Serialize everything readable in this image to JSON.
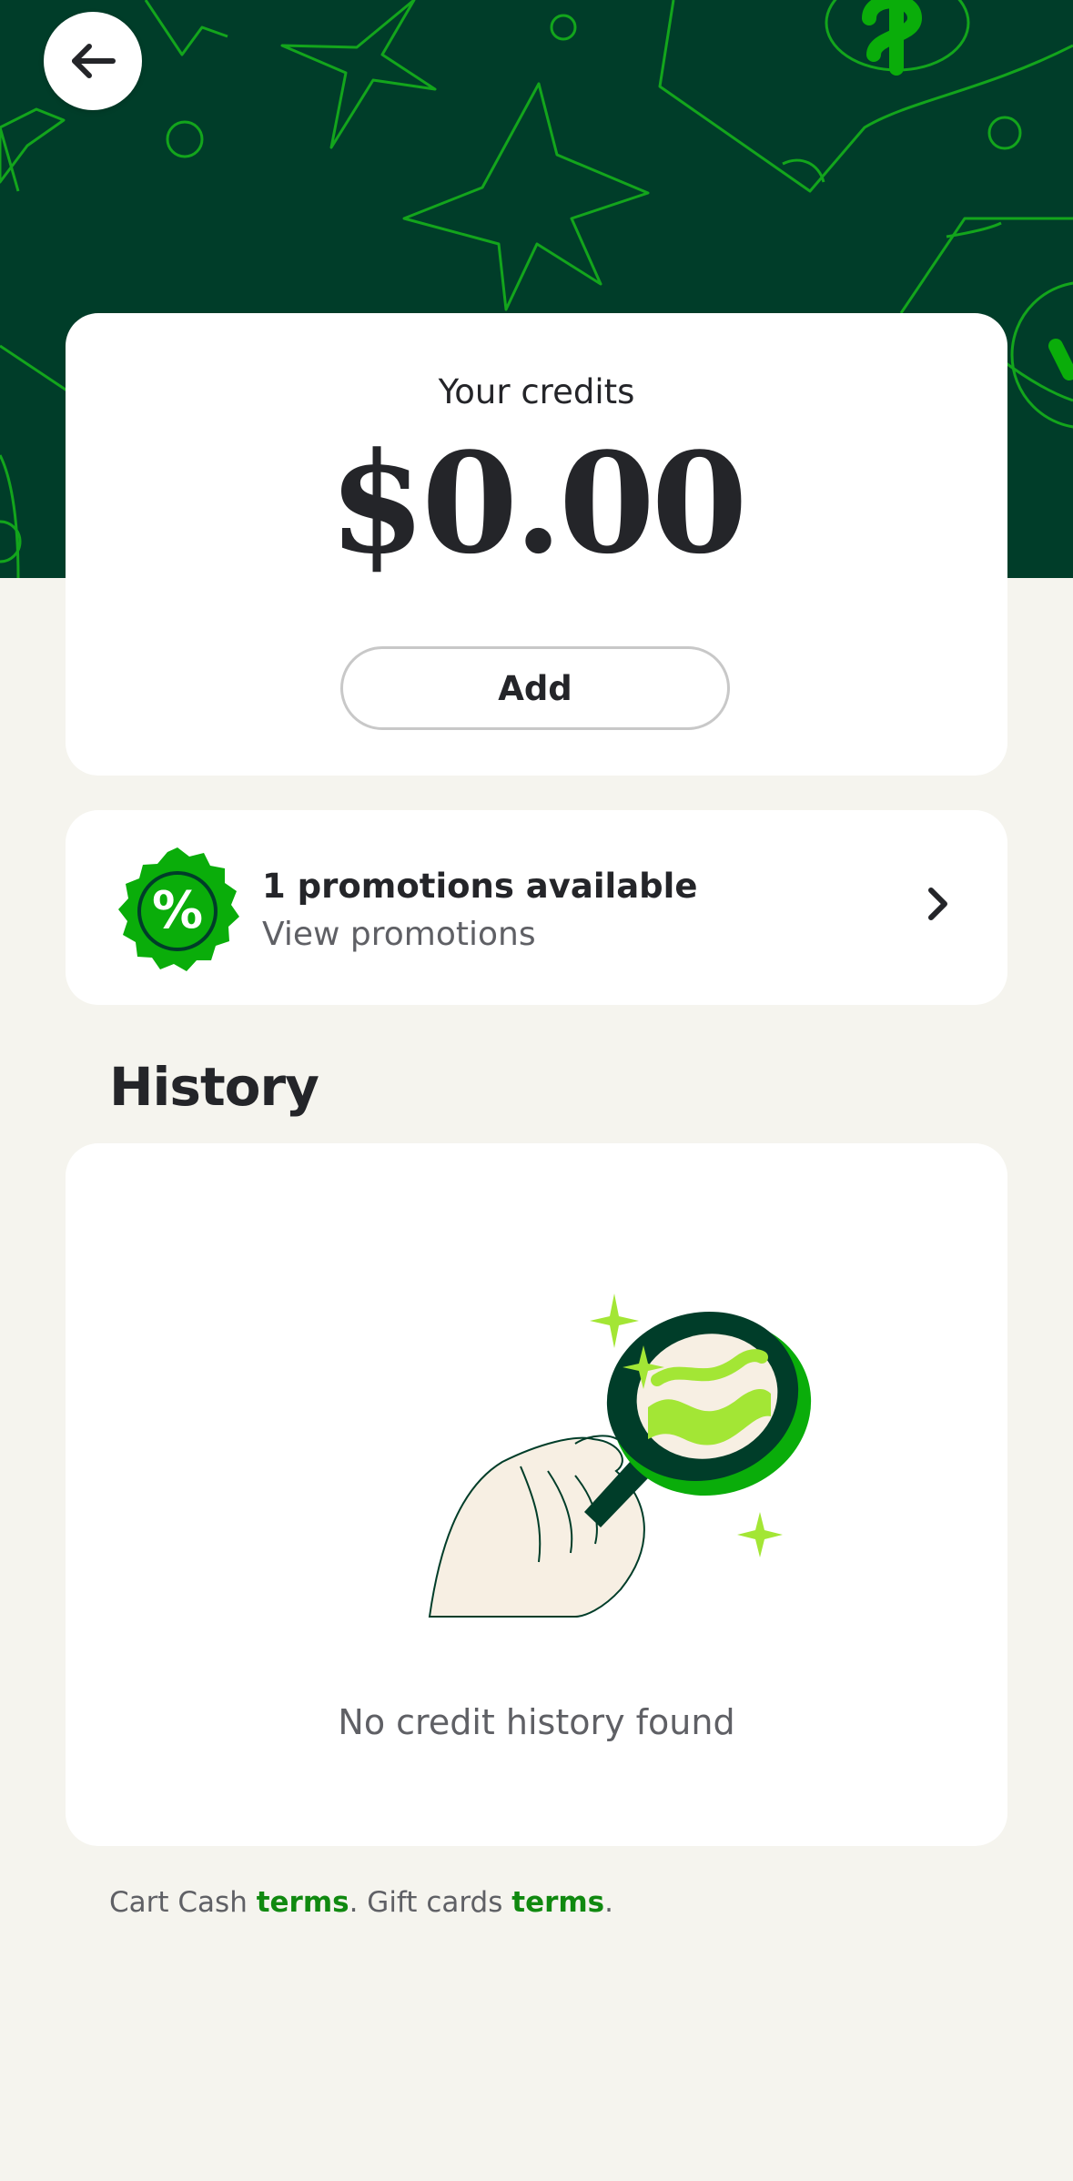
{
  "header": {
    "back_icon": "arrow-left-icon",
    "pattern": "stars-and-money-pattern"
  },
  "credits": {
    "label": "Your credits",
    "amount": "$0.00",
    "add_label": "Add"
  },
  "promotions": {
    "badge_icon": "percent-badge-icon",
    "title": "1 promotions available",
    "subtitle": "View promotions",
    "chevron_icon": "chevron-right-icon"
  },
  "history": {
    "heading": "History",
    "illustration": "hand-magnifier-illustration",
    "empty_text": "No credit history found"
  },
  "footer": {
    "part1": "Cart Cash ",
    "link1": "terms",
    "part2": ". Gift cards ",
    "link2": "terms",
    "part3": "."
  },
  "colors": {
    "hero_bg": "#003d29",
    "accent_green": "#0aad0a",
    "link_green": "#108910",
    "lime": "#a3e635",
    "page_bg": "#f5f4ee"
  }
}
